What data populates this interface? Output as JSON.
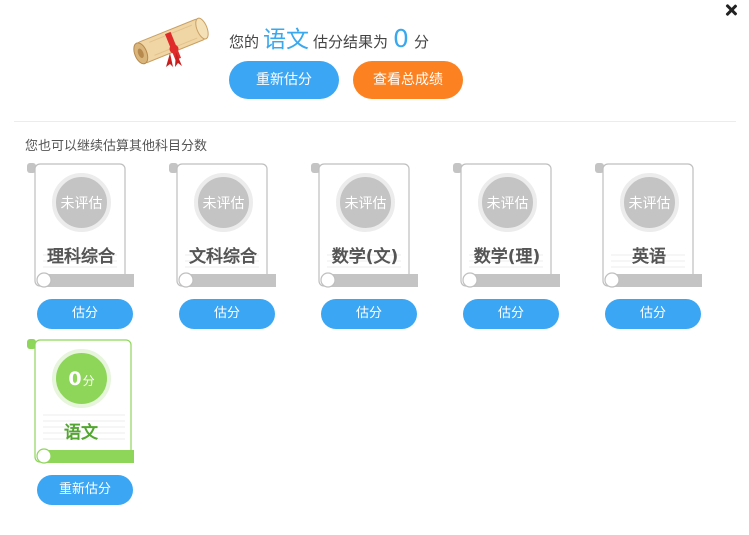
{
  "header": {
    "result_prefix": "您的",
    "subject": "语文",
    "result_middle": "估分结果为",
    "score": "0",
    "result_suffix": "分",
    "retry_label": "重新估分",
    "total_label": "查看总成绩"
  },
  "hint": "您也可以继续估算其他科目分数",
  "subjects": [
    {
      "name": "理科综合",
      "status": "未评估",
      "button": "估分"
    },
    {
      "name": "文科综合",
      "status": "未评估",
      "button": "估分"
    },
    {
      "name": "数学(文)",
      "status": "未评估",
      "button": "估分"
    },
    {
      "name": "数学(理)",
      "status": "未评估",
      "button": "估分"
    },
    {
      "name": "英语",
      "status": "未评估",
      "button": "估分"
    },
    {
      "name": "语文",
      "score": "0",
      "unit": "分",
      "button": "重新估分"
    }
  ],
  "icons": {
    "close": "close-icon",
    "scroll": "scroll-diploma-icon"
  },
  "colors": {
    "blue": "#3ba6f4",
    "orange": "#fb8121",
    "green": "#8ed659",
    "gray": "#c4c4c4"
  }
}
